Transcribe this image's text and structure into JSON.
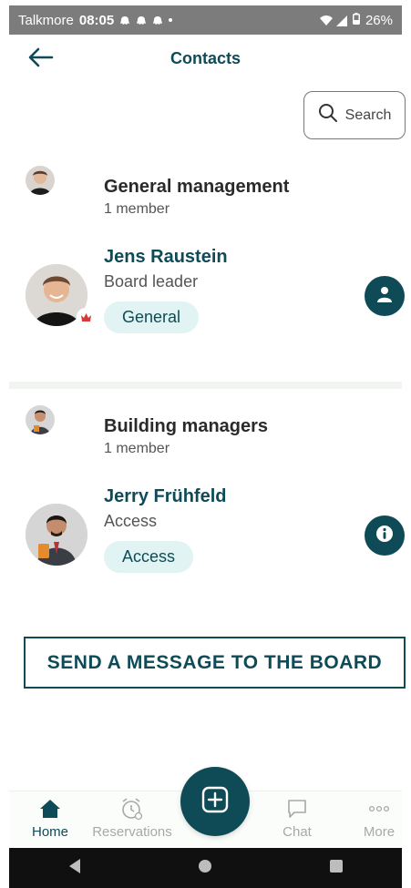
{
  "status_bar": {
    "carrier": "Talkmore",
    "time": "08:05",
    "battery": "26%"
  },
  "header": {
    "title": "Contacts"
  },
  "search": {
    "label": "Search"
  },
  "groups": [
    {
      "title": "General management",
      "member_count": "1 member",
      "member": {
        "name": "Jens Raustein",
        "role": "Board leader",
        "tag": "General",
        "action_icon": "person-icon"
      }
    },
    {
      "title": "Building managers",
      "member_count": "1 member",
      "member": {
        "name": "Jerry Frühfeld",
        "role": "Access",
        "tag": "Access",
        "action_icon": "info-icon"
      }
    }
  ],
  "cta": {
    "label": "SEND A MESSAGE TO THE BOARD"
  },
  "tabbar": {
    "items": [
      {
        "label": "Home",
        "icon": "home-icon",
        "active": true
      },
      {
        "label": "Reservations",
        "icon": "alarm-clock-icon",
        "active": false
      },
      {
        "label": "Chat",
        "icon": "chat-bubble-icon",
        "active": false
      },
      {
        "label": "More",
        "icon": "more-dots-icon",
        "active": false
      }
    ],
    "fab_icon": "add-icon"
  },
  "colors": {
    "accent": "#0f4b57",
    "tag_bg": "#e2f3f3",
    "status_bar": "#7c7c7c"
  }
}
